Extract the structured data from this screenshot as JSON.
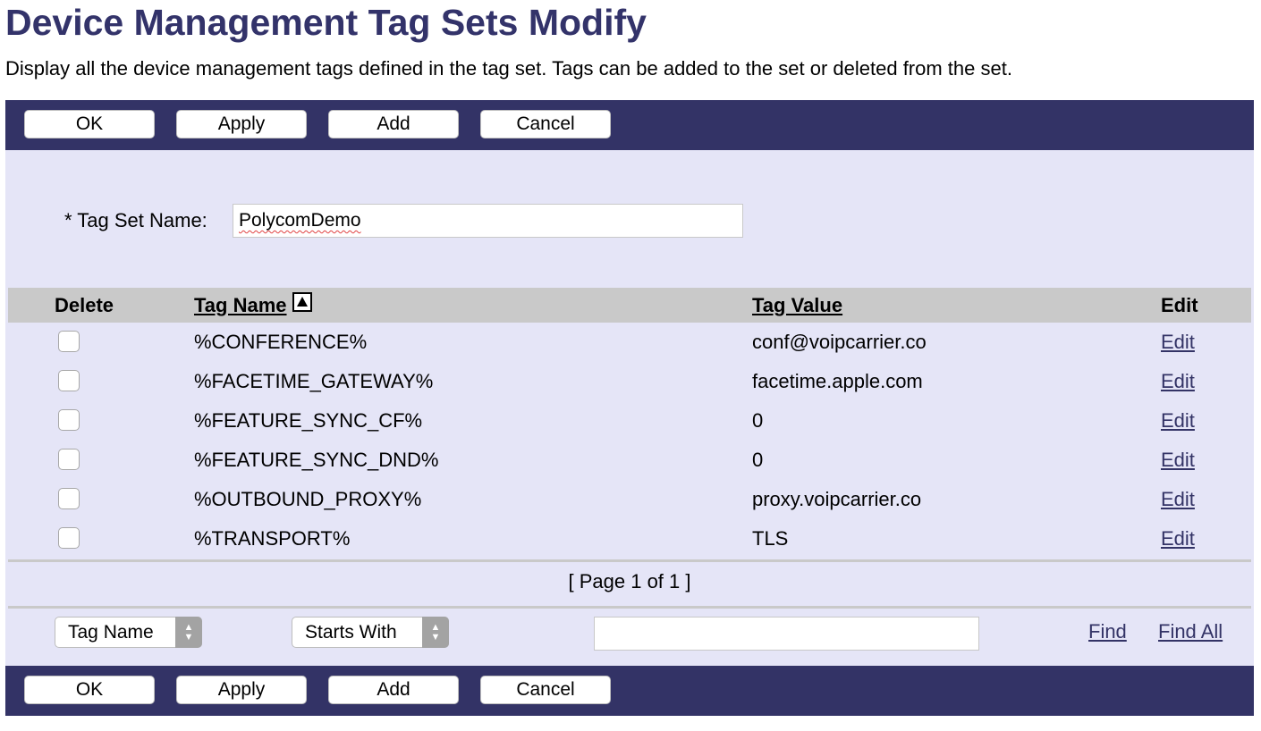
{
  "page": {
    "title": "Device Management Tag Sets Modify",
    "subtitle": "Display all the device management tags defined in the tag set. Tags can be added to the set or deleted from the set."
  },
  "toolbar": {
    "ok_label": "OK",
    "apply_label": "Apply",
    "add_label": "Add",
    "cancel_label": "Cancel"
  },
  "form": {
    "tag_set_name_label": "* Tag Set Name:",
    "tag_set_name_value": "PolycomDemo"
  },
  "table": {
    "headers": {
      "delete": "Delete",
      "tag_name": "Tag Name",
      "tag_value": "Tag Value",
      "edit": "Edit"
    },
    "sort": {
      "column": "Tag Name",
      "direction": "ascending",
      "icon": "sort-ascending-icon"
    },
    "rows": [
      {
        "tag_name": "%CONFERENCE%",
        "tag_value": "conf@voipcarrier.co",
        "edit": "Edit"
      },
      {
        "tag_name": "%FACETIME_GATEWAY%",
        "tag_value": "facetime.apple.com",
        "edit": "Edit"
      },
      {
        "tag_name": "%FEATURE_SYNC_CF%",
        "tag_value": "0",
        "edit": "Edit"
      },
      {
        "tag_name": "%FEATURE_SYNC_DND%",
        "tag_value": "0",
        "edit": "Edit"
      },
      {
        "tag_name": "%OUTBOUND_PROXY%",
        "tag_value": "proxy.voipcarrier.co",
        "edit": "Edit"
      },
      {
        "tag_name": "%TRANSPORT%",
        "tag_value": "TLS",
        "edit": "Edit"
      }
    ],
    "pager": "[ Page 1 of 1 ]"
  },
  "search": {
    "field_select": "Tag Name",
    "mode_select": "Starts With",
    "query_value": "",
    "find_label": "Find",
    "find_all_label": "Find All"
  },
  "colors": {
    "toolbar": "#333366",
    "title": "#33336a",
    "panel": "#e5e5f7",
    "header_row": "#c9c9c9",
    "link": "#333366"
  }
}
